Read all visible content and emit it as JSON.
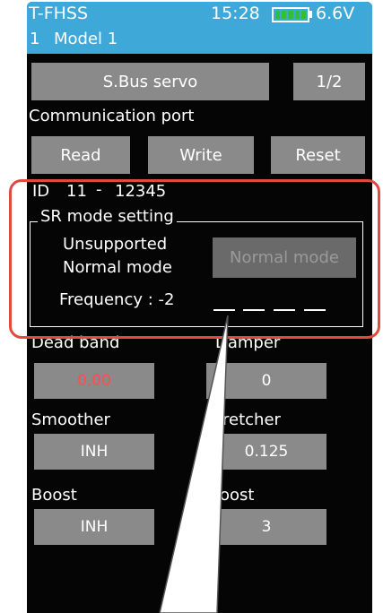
{
  "status": {
    "title": "T-FHSS",
    "time": "15:28",
    "voltage": "6.6V"
  },
  "model": {
    "number": "1",
    "name": "Model 1"
  },
  "top_buttons": {
    "servo": "S.Bus servo",
    "page": "1/2"
  },
  "comm": {
    "label": "Communication port",
    "read": "Read",
    "write": "Write",
    "reset": "Reset"
  },
  "id": {
    "prefix": "ID",
    "value1": "11",
    "sep": "-",
    "value2": "12345"
  },
  "sr_mode": {
    "legend": "SR mode setting",
    "unsupported_line1": "Unsupported",
    "unsupported_line2": "Normal mode",
    "mode_button": "Normal mode",
    "frequency_label": "Frequency : -2"
  },
  "params": {
    "dead_band": {
      "label": "Dead band",
      "value": "0.00"
    },
    "damper": {
      "label": "Damper",
      "value": "0"
    },
    "smoother": {
      "label": "Smoother",
      "value": "INH"
    },
    "stretcher": {
      "label": "retcher",
      "value": "0.125"
    },
    "boost": {
      "label": "Boost",
      "value": "INH"
    },
    "boost2": {
      "label": "oost",
      "value": "3"
    }
  },
  "colors": {
    "accent": "#3ea8d9",
    "button": "#8a8a8a",
    "alert": "#ff4d4d",
    "highlight": "#e14a3c"
  }
}
